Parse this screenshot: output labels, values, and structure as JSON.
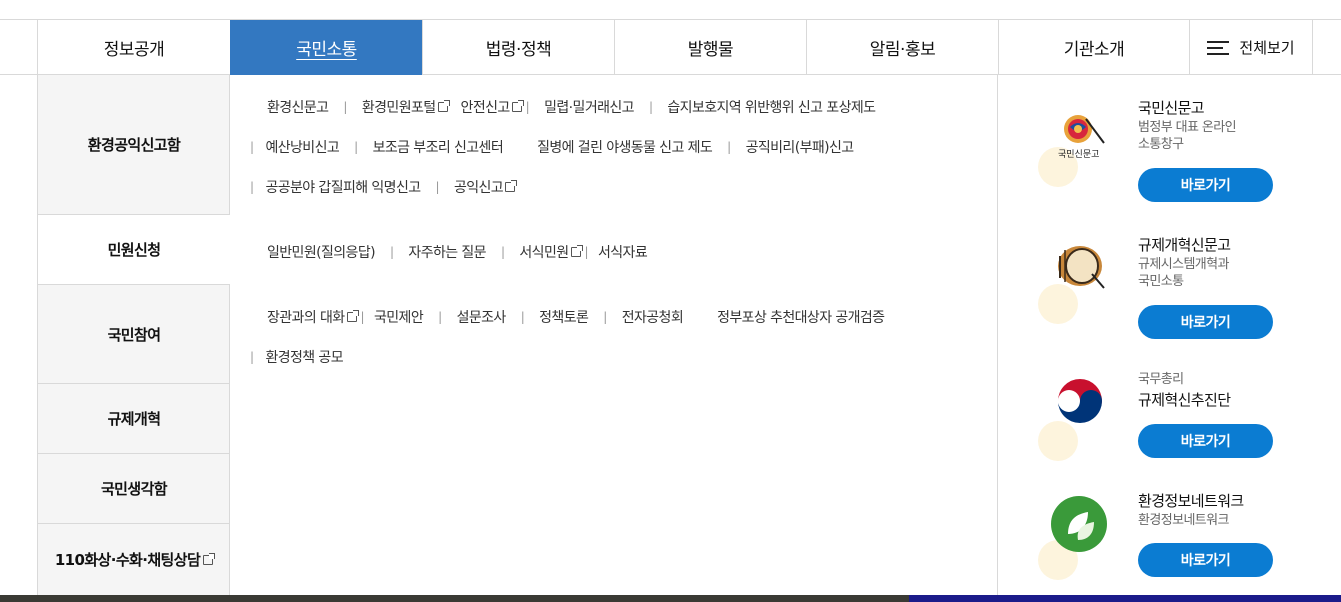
{
  "nav": {
    "items": [
      "정보공개",
      "국민소통",
      "법령·정책",
      "발행물",
      "알림·홍보",
      "기관소개"
    ],
    "all_label": "전체보기"
  },
  "sidebar": {
    "items": [
      "환경공익신고함",
      "민원신청",
      "국민참여",
      "규제개혁",
      "국민생각함",
      "110화상·수화·채팅상담"
    ]
  },
  "content": {
    "row1": [
      "환경신문고",
      "환경민원포털",
      "안전신고",
      "밀렵·밀거래신고",
      "습지보호지역 위반행위 신고 포상제도"
    ],
    "row2": [
      "예산낭비신고",
      "보조금 부조리 신고센터",
      "질병에 걸린 야생동물 신고 제도",
      "공직비리(부패)신고"
    ],
    "row3": [
      "공공분야 갑질피해 익명신고",
      "공익신고"
    ],
    "row4": [
      "일반민원(질의응답)",
      "자주하는 질문",
      "서식민원",
      "서식자료"
    ],
    "row5": [
      "장관과의 대화",
      "국민제안",
      "설문조사",
      "정책토론",
      "전자공청회",
      "정부포상 추천대상자 공개검증"
    ],
    "row6": [
      "환경정책 공모"
    ]
  },
  "promos": [
    {
      "title": "국민신문고",
      "desc1": "범정부 대표 온라인",
      "desc2": "소통창구",
      "button": "바로가기",
      "logo_text": "국민신문고"
    },
    {
      "title": "규제개혁신문고",
      "desc1": "규제시스템개혁과",
      "desc2": "국민소통",
      "button": "바로가기"
    },
    {
      "title": "규제혁신추진단",
      "subtitle": "국무총리",
      "button": "바로가기"
    },
    {
      "title": "환경정보네트워크",
      "desc1": "환경정보네트워크",
      "button": "바로가기"
    }
  ],
  "colors": {
    "accent": "#3378c1",
    "button": "#0b7cd2",
    "sidebar_bg": "#f5f5f5"
  }
}
